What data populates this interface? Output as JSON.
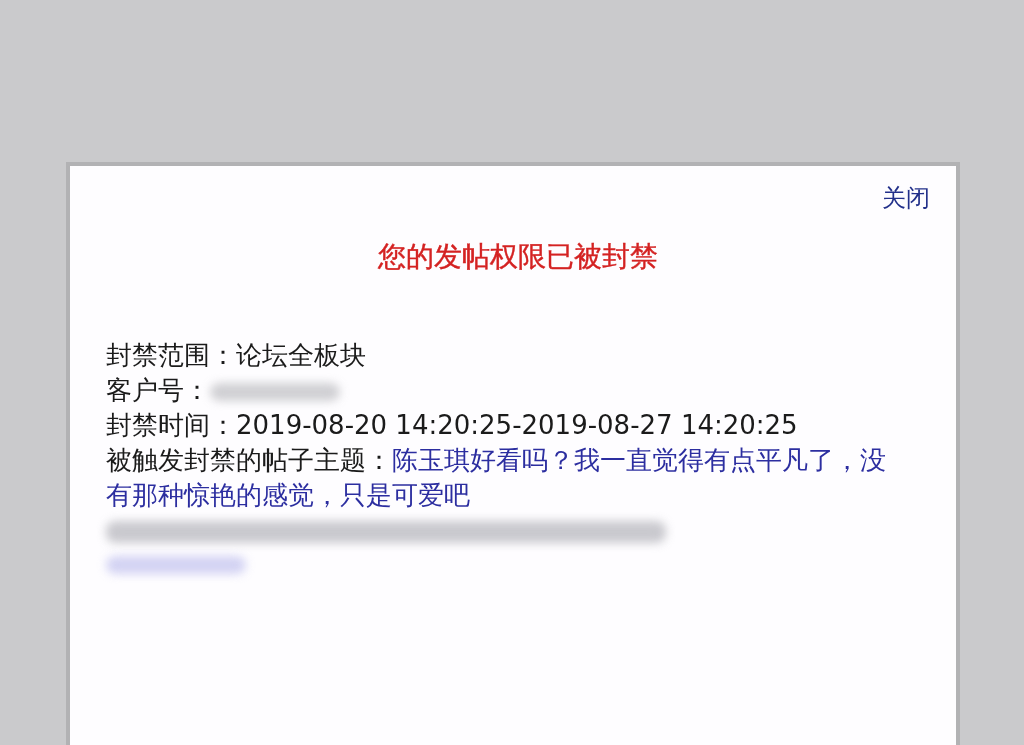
{
  "dialog": {
    "close_label": "关闭",
    "title": "您的发帖权限已被封禁",
    "fields": [
      {
        "kind": "text",
        "label": "封禁范围：",
        "value": "论坛全板块"
      },
      {
        "kind": "redacted",
        "label": "客户号："
      },
      {
        "kind": "text",
        "label": "封禁时间：",
        "value": "2019-08-20 14:20:25-2019-08-27 14:20:25"
      },
      {
        "kind": "link",
        "label": "被触发封禁的帖子主题：",
        "value": "陈玉琪好看吗？我一直觉得有点平凡了，没有那种惊艳的感觉，只是可爱吧"
      },
      {
        "kind": "redacted"
      }
    ]
  }
}
